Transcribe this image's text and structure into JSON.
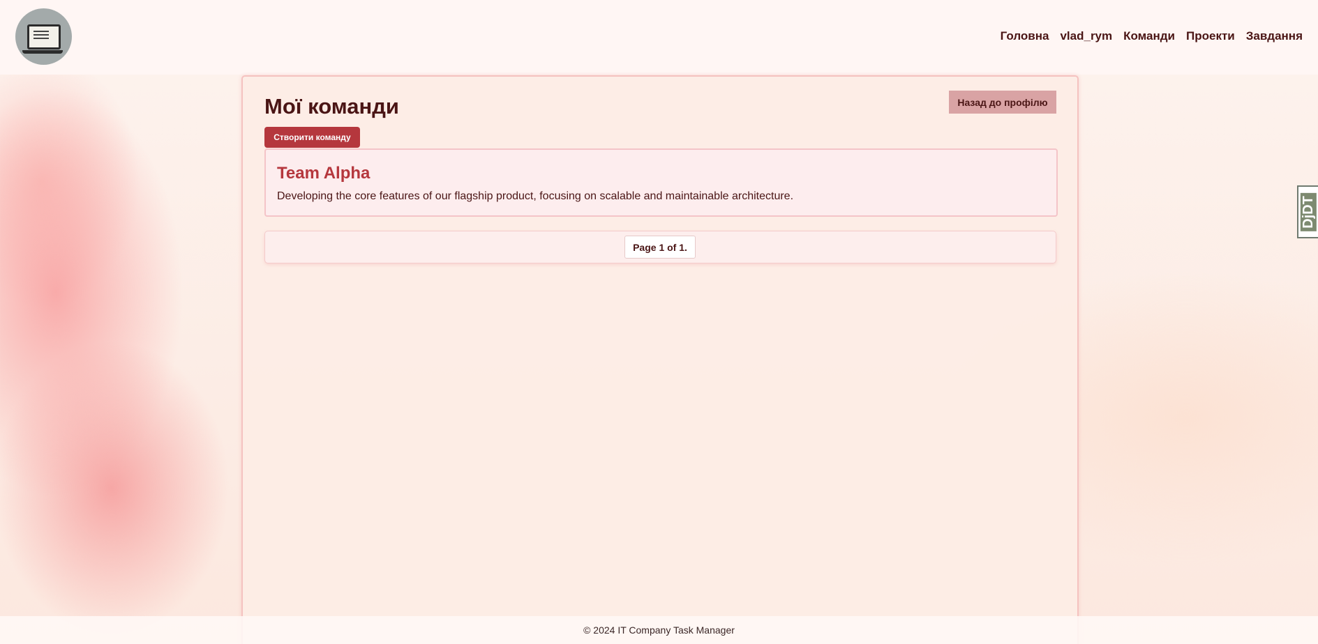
{
  "nav": {
    "items": [
      {
        "label": "Головна"
      },
      {
        "label": "vlad_rym"
      },
      {
        "label": "Команди"
      },
      {
        "label": "Проекти"
      },
      {
        "label": "Завдання"
      }
    ]
  },
  "page": {
    "title": "Мої команди",
    "back_button": "Назад до профілю",
    "create_button": "Створити команду"
  },
  "teams": [
    {
      "name": "Team Alpha",
      "description": "Developing the core features of our flagship product, focusing on scalable and maintainable architecture."
    }
  ],
  "pagination": {
    "label": "Page 1 of 1."
  },
  "debug_toolbar": {
    "label": "DjDT"
  },
  "footer": {
    "text": "© 2024 IT Company Task Manager"
  },
  "colors": {
    "brand_dark": "#4a1515",
    "accent_red": "#b5373d",
    "back_button_bg": "#d9a3a4"
  },
  "icons": {
    "logo": "laptop-logo-icon"
  }
}
